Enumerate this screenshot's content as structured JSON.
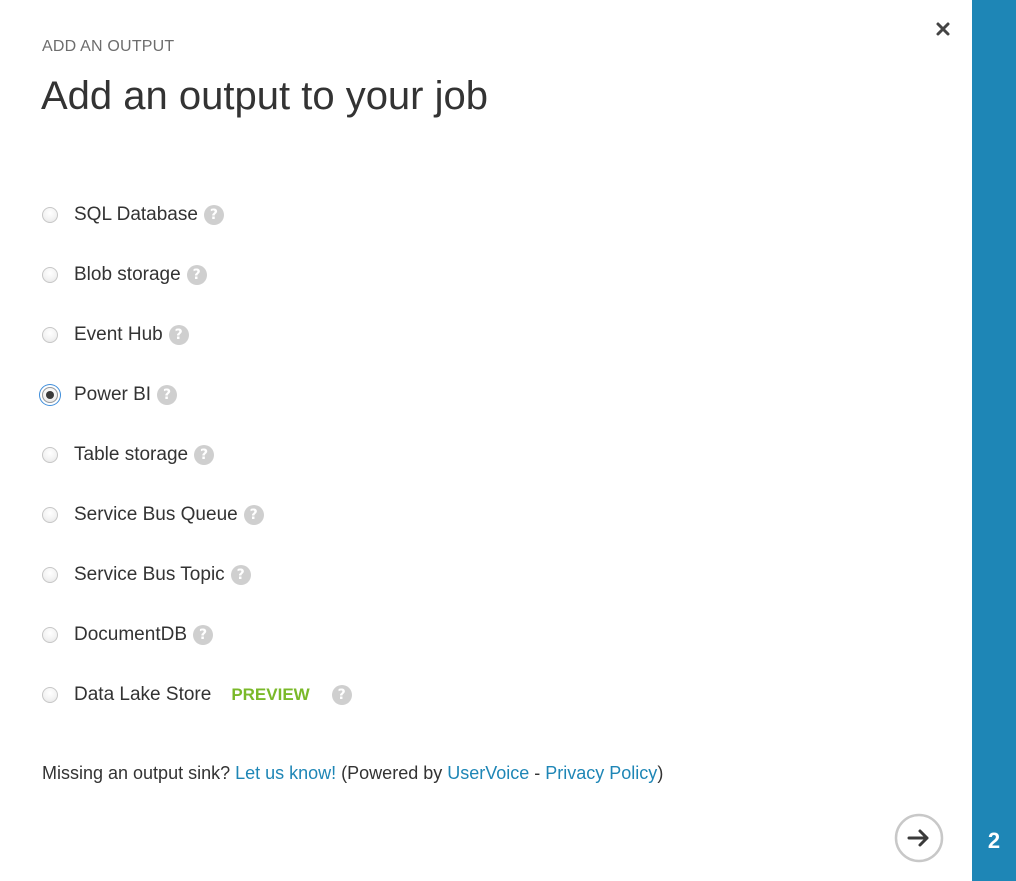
{
  "dialog": {
    "subtitle": "ADD AN OUTPUT",
    "title": "Add an output to your job"
  },
  "options": [
    {
      "label": "SQL Database",
      "checked": false,
      "help_icon": "question-mark"
    },
    {
      "label": "Blob storage",
      "checked": false,
      "help_icon": "question-mark"
    },
    {
      "label": "Event Hub",
      "checked": false,
      "help_icon": "question-mark"
    },
    {
      "label": "Power BI",
      "checked": true,
      "help_icon": "question-mark"
    },
    {
      "label": "Table storage",
      "checked": false,
      "help_icon": "question-mark"
    },
    {
      "label": "Service Bus Queue",
      "checked": false,
      "help_icon": "question-mark"
    },
    {
      "label": "Service Bus Topic",
      "checked": false,
      "help_icon": "question-mark"
    },
    {
      "label": "DocumentDB",
      "checked": false,
      "help_icon": "question-mark"
    },
    {
      "label": "Data Lake Store",
      "checked": false,
      "badge": "PREVIEW",
      "help_icon": "question-mark"
    }
  ],
  "help_glyph": "?",
  "footer": {
    "prefix": "Missing an output sink? ",
    "link_feedback": "Let us know!",
    "middle": " (Powered by ",
    "link_uservoice": "UserVoice",
    "separator": " - ",
    "link_privacy": "Privacy Policy",
    "suffix": ")"
  },
  "wizard": {
    "step_number": "2",
    "next_icon": "arrow-right-circle-icon",
    "close_icon": "close-icon"
  },
  "colors": {
    "accent": "#1e86b6",
    "preview_badge": "#7ab929",
    "help_icon_bg": "#cfcfcf",
    "text": "#333333"
  }
}
